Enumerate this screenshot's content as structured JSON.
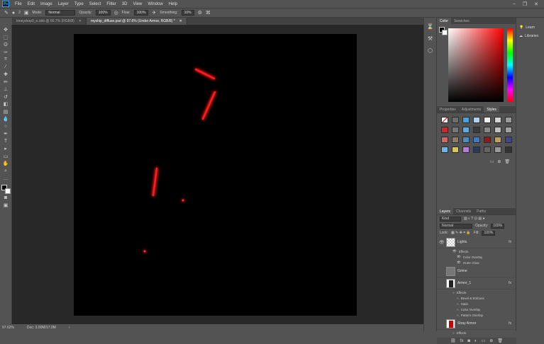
{
  "app": {
    "logo_text": "Ps"
  },
  "menu": [
    "File",
    "Edit",
    "Image",
    "Layer",
    "Type",
    "Select",
    "Filter",
    "3D",
    "View",
    "Window",
    "Help"
  ],
  "window_controls": [
    "–",
    "❐",
    "✕"
  ],
  "options_bar": {
    "brush_size": "2",
    "mode_label": "Mode:",
    "mode_value": "Normal",
    "opacity_label": "Opacity:",
    "opacity_value": "100%",
    "flow_label": "Flow:",
    "flow_value": "100%",
    "smoothing_label": "Smoothing:",
    "smoothing_value": "10%"
  },
  "tabs": [
    {
      "title": "loneydrop0_n.obb @ 66.7% (RGB/8)",
      "close": "✕",
      "active": false
    },
    {
      "title": "myship_diffuse.psd @ 97.6% (Under Armor, RGB/8) *",
      "close": "✕",
      "active": true
    }
  ],
  "status": {
    "zoom": "97.62%",
    "doc": "Doc: 3.00M/17.0M"
  },
  "color_panel": {
    "tabs": [
      "Color",
      "Swatches"
    ]
  },
  "styles_panel": {
    "tabs": [
      "Properties",
      "Adjustments",
      "Styles"
    ],
    "swatch_colors": [
      "#e8e8e8",
      "#6e6e6e",
      "#4aa0d8",
      "#b0d0f0",
      "#f0f0f0",
      "#d4d4d4",
      "#9a9a9a",
      "#cc2a2a",
      "#777777",
      "#5fa8e0",
      "#3a3a3a",
      "#888888",
      "#c0c0c0",
      "#a0a0a0",
      "#d06868",
      "#8a7d6b",
      "#4a8fc0",
      "#3d7abf",
      "#8c1c1c",
      "#bfa060",
      "#444488",
      "#6fb6e6",
      "#d6c35a",
      "#b27dd6",
      "#2a3a5a",
      "#666666",
      "#999999",
      "#333333"
    ]
  },
  "layers_panel": {
    "tabs": [
      "Layers",
      "Channels",
      "Paths"
    ],
    "kind": "Kind",
    "blend_mode": "Normal",
    "opacity_label": "Opacity:",
    "opacity_value": "100%",
    "lock_label": "Lock:",
    "fill_label": "Fill:",
    "fill_value": "100%",
    "layers": [
      {
        "name": "Lights",
        "fx": "fx",
        "thumb": "checker",
        "visible": true,
        "effects_label": "Effects",
        "effects": [
          "Color Overlay",
          "Outer Glow"
        ]
      },
      {
        "name": "Grime",
        "fx": "",
        "thumb": "grime",
        "visible": false,
        "effects_label": "",
        "effects": []
      },
      {
        "name": "Armor_1",
        "fx": "fx",
        "thumb": "armor",
        "visible": false,
        "effects_label": "Effects",
        "effects": [
          "Bevel & Emboss",
          "Satin",
          "Color Overlay",
          "Pattern Overlay"
        ]
      },
      {
        "name": "Stray Armor",
        "fx": "fx",
        "thumb": "red",
        "visible": false,
        "effects_label": "Effects",
        "effects": []
      }
    ]
  },
  "right_strip": [
    {
      "icon": "lightbulb-icon",
      "label": "Learn"
    },
    {
      "icon": "libraries-icon",
      "label": "Libraries"
    }
  ],
  "canvas": {
    "background": "#000000",
    "glow_color": "#ff1a1a"
  }
}
